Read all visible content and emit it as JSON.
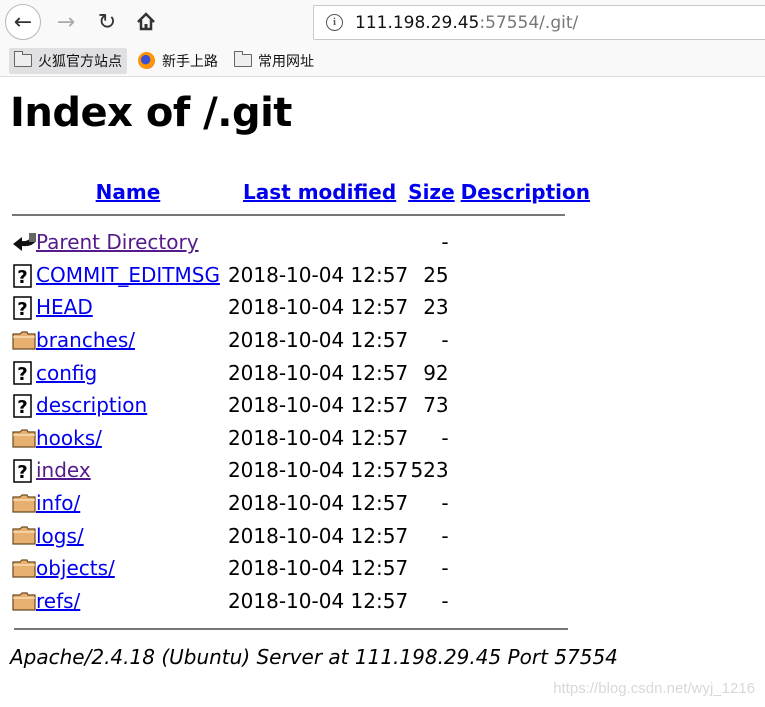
{
  "browser": {
    "url_host": "111.198.29.45",
    "url_path": ":57554/.git/",
    "bookmarks": [
      {
        "label": "火狐官方站点",
        "icon": "folder-icon"
      },
      {
        "label": "新手上路",
        "icon": "firefox-icon"
      },
      {
        "label": "常用网址",
        "icon": "folder-icon"
      }
    ]
  },
  "page": {
    "title": "Index of /.git",
    "headers": {
      "name": "Name",
      "last_modified": "Last modified",
      "size": "Size",
      "description": "Description"
    },
    "rows": [
      {
        "icon": "back-icon",
        "name": "Parent Directory",
        "date": "",
        "size": "-",
        "visited": true
      },
      {
        "icon": "unknown-file-icon",
        "name": "COMMIT_EDITMSG",
        "date": "2018-10-04 12:57",
        "size": "25",
        "visited": false
      },
      {
        "icon": "unknown-file-icon",
        "name": "HEAD",
        "date": "2018-10-04 12:57",
        "size": "23",
        "visited": false
      },
      {
        "icon": "folder-icon",
        "name": "branches/",
        "date": "2018-10-04 12:57",
        "size": "-",
        "visited": false
      },
      {
        "icon": "unknown-file-icon",
        "name": "config",
        "date": "2018-10-04 12:57",
        "size": "92",
        "visited": false
      },
      {
        "icon": "unknown-file-icon",
        "name": "description",
        "date": "2018-10-04 12:57",
        "size": "73",
        "visited": false
      },
      {
        "icon": "folder-icon",
        "name": "hooks/",
        "date": "2018-10-04 12:57",
        "size": "-",
        "visited": false
      },
      {
        "icon": "unknown-file-icon",
        "name": "index",
        "date": "2018-10-04 12:57",
        "size": "523",
        "visited": true
      },
      {
        "icon": "folder-icon",
        "name": "info/",
        "date": "2018-10-04 12:57",
        "size": "-",
        "visited": false
      },
      {
        "icon": "folder-icon",
        "name": "logs/",
        "date": "2018-10-04 12:57",
        "size": "-",
        "visited": false
      },
      {
        "icon": "folder-icon",
        "name": "objects/",
        "date": "2018-10-04 12:57",
        "size": "-",
        "visited": false
      },
      {
        "icon": "folder-icon",
        "name": "refs/",
        "date": "2018-10-04 12:57",
        "size": "-",
        "visited": false
      }
    ],
    "address": "Apache/2.4.18 (Ubuntu) Server at 111.198.29.45 Port 57554"
  },
  "watermark": "https://blog.csdn.net/wyj_1216",
  "colors": {
    "link": "#0000ee",
    "visited": "#551a8b",
    "folder": "#e8b070"
  }
}
